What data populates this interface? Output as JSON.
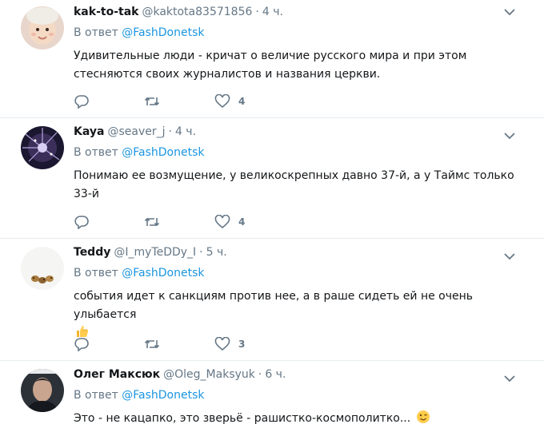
{
  "reply_prefix": "В ответ",
  "tweets": [
    {
      "name": "kak-to-tak",
      "handle": "@kaktota83571856",
      "separator": "·",
      "time": "4 ч.",
      "reply_to": "@FashDonetsk",
      "text": "Удивительные люди - кричат о величие русского мира и при этом стесняются своих журналистов и названия церкви.",
      "like_count": "4"
    },
    {
      "name": "Kaya",
      "handle": "@seaver_j",
      "separator": "·",
      "time": "4 ч.",
      "reply_to": "@FashDonetsk",
      "text": "Понимаю ее возмущение, у великоскрепных давно 37-й, а у Таймс только 33-й",
      "like_count": "4"
    },
    {
      "name": "Teddy",
      "handle": "@I_myTeDDy_I",
      "separator": "·",
      "time": "5 ч.",
      "reply_to": "@FashDonetsk",
      "text": "события идет к санкциям против нее, а в раше сидеть ей не очень улыбается",
      "like_count": "3",
      "emoji": "thumbs-up-emoji"
    },
    {
      "name": "Олег Максюк",
      "handle": "@Oleg_Maksyuk",
      "separator": "·",
      "time": "6 ч.",
      "reply_to": "@FashDonetsk",
      "text": "Это - не кацапко, это зверьё - рашистко-космополитко...",
      "emoji": "winking-face-emoji"
    }
  ],
  "colors": {
    "link": "#1b95e0",
    "secondary_text": "#657786",
    "divider": "#e6ecf0",
    "name_text": "#14171a"
  },
  "icons": [
    "reply-icon",
    "retweet-icon",
    "like-icon",
    "chevron-down-icon"
  ]
}
